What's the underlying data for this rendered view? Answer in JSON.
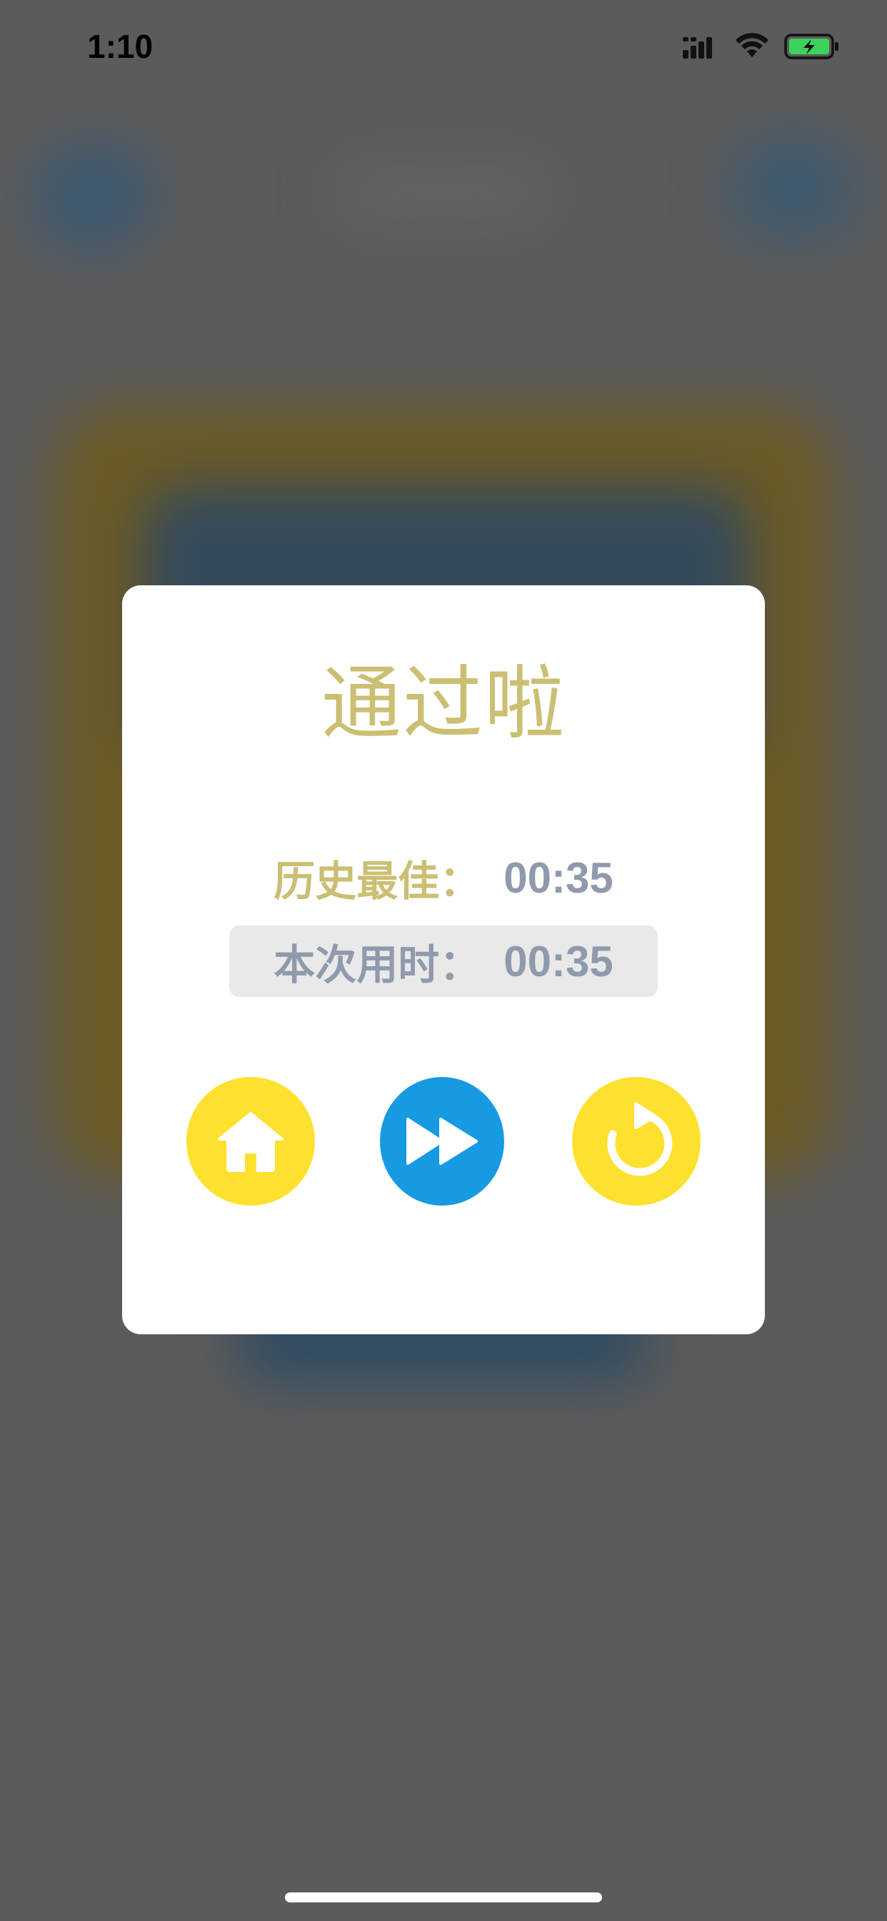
{
  "status_bar": {
    "time": "1:10",
    "battery_icon": "battery-charging-icon",
    "wifi_icon": "wifi-icon",
    "cellular_icon": "cellular-signal-icon"
  },
  "dialog": {
    "title": "通过啦",
    "best": {
      "label": "历史最佳：",
      "value": "00:35"
    },
    "current": {
      "label": "本次用时：",
      "value": "00:35"
    },
    "buttons": [
      {
        "icon": "home-icon",
        "color": "#fee12e"
      },
      {
        "icon": "fast-forward-icon",
        "color": "#169ae1"
      },
      {
        "icon": "restart-icon",
        "color": "#fee12e"
      }
    ]
  },
  "colors": {
    "title": "#cbbf73",
    "value_text": "#909aad",
    "overlay": "#5b5b5b",
    "battery_fill": "#3dd35a"
  }
}
